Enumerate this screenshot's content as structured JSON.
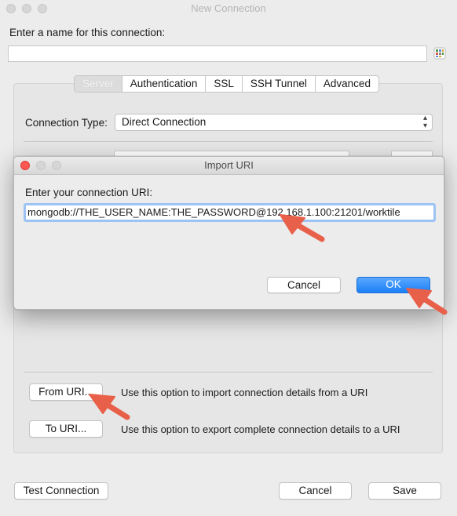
{
  "window": {
    "title": "New Connection"
  },
  "name_section": {
    "label": "Enter a name for this connection:",
    "value": ""
  },
  "tabs": [
    {
      "label": "Server",
      "selected": true
    },
    {
      "label": "Authentication",
      "selected": false
    },
    {
      "label": "SSL",
      "selected": false
    },
    {
      "label": "SSH Tunnel",
      "selected": false
    },
    {
      "label": "Advanced",
      "selected": false
    }
  ],
  "connection_type": {
    "label": "Connection Type:",
    "value": "Direct Connection"
  },
  "uri_options": {
    "from_button": "From URI...",
    "from_desc": "Use this option to import connection details from a URI",
    "to_button": "To URI...",
    "to_desc": "Use this option to export complete connection details to a URI"
  },
  "footer": {
    "test_button": "Test Connection",
    "cancel_button": "Cancel",
    "save_button": "Save"
  },
  "import_dialog": {
    "title": "Import URI",
    "label": "Enter your connection URI:",
    "uri_value": "mongodb://THE_USER_NAME:THE_PASSWORD@192.168.1.100:21201/worktile",
    "cancel_button": "Cancel",
    "ok_button": "OK"
  },
  "colors": {
    "accent": "#1b7ff5",
    "annotation_arrow": "#e8604a",
    "close_red": "#fc5753"
  }
}
